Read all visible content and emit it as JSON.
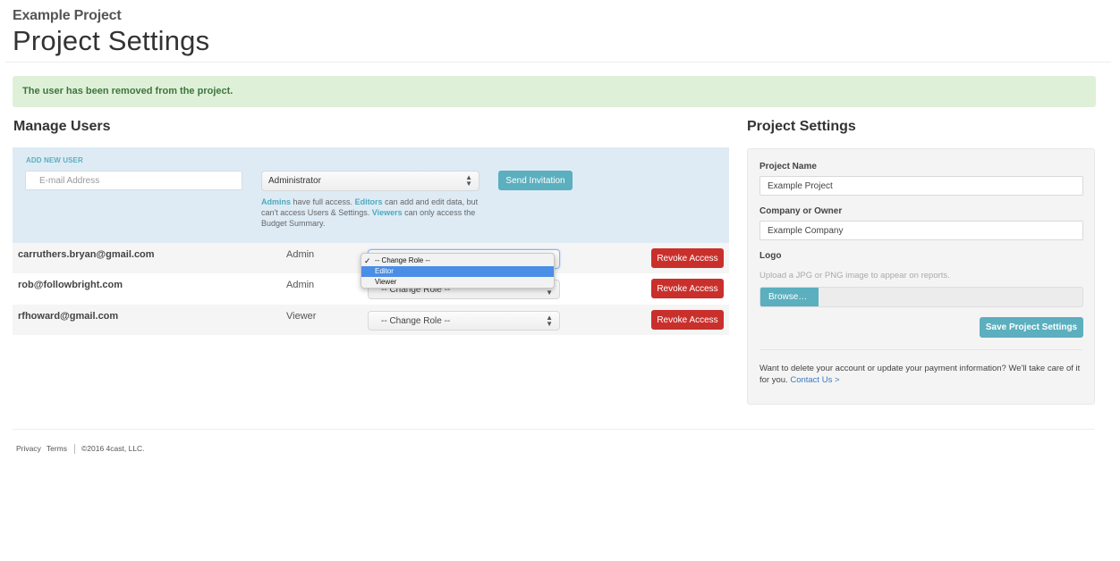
{
  "header": {
    "project_name": "Example Project",
    "page_title": "Project Settings"
  },
  "alert": {
    "message": "The user has been removed from the project.",
    "color": "#dff0d8"
  },
  "manage_users": {
    "title": "Manage Users",
    "add_new_user": {
      "label": "ADD NEW USER",
      "email_placeholder": "E-mail Address",
      "email_value": "",
      "role_selected": "Administrator",
      "send_button": "Send Invitation",
      "help": {
        "admins": "Admins",
        "admins_text": " have full access. ",
        "editors": "Editors",
        "editors_text": " can add and edit data, but can't access Users & Settings. ",
        "viewers": "Viewers",
        "viewers_text": " can only access the Budget Summary."
      }
    },
    "users": [
      {
        "email": "carruthers.bryan@gmail.com",
        "role": "Admin",
        "change_role": "-- Change Role --",
        "revoke": "Revoke Access"
      },
      {
        "email": "rob@followbright.com",
        "role": "Admin",
        "change_role": "-- Change Role --",
        "revoke": "Revoke Access"
      },
      {
        "email": "rfhoward@gmail.com",
        "role": "Viewer",
        "change_role": "-- Change Role --",
        "revoke": "Revoke Access"
      }
    ],
    "open_dropdown": {
      "options": [
        "-- Change Role --",
        "Editor",
        "Viewer"
      ],
      "checked": "-- Change Role --",
      "highlighted": "Editor"
    }
  },
  "project_settings": {
    "title": "Project Settings",
    "project_name_label": "Project Name",
    "project_name_value": "Example Project",
    "company_label": "Company or Owner",
    "company_value": "Example Company",
    "logo_label": "Logo",
    "logo_help": "Upload a JPG or PNG image to appear on reports.",
    "browse_button": "Browse…",
    "save_button": "Save Project Settings",
    "delete_note": "Want to delete your account or update your payment information? We'll take care of it for you. ",
    "contact_link": "Contact Us >"
  },
  "footer": {
    "privacy": "Privacy",
    "terms": "Terms",
    "copyright": "©2016 4cast, LLC."
  },
  "colors": {
    "accent": "#5bafbe",
    "danger": "#c9302c",
    "add_panel_bg": "#deebf5"
  }
}
